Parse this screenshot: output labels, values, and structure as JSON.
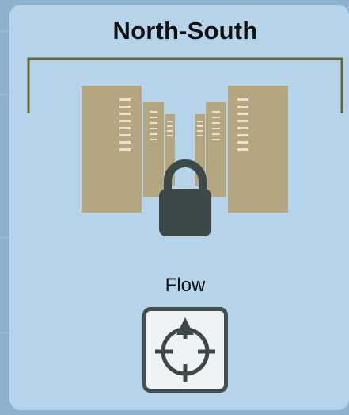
{
  "diagram": {
    "title": "North-South",
    "flow_label": "Flow",
    "colors": {
      "server": "#b5a682",
      "server_dark": "#9b8f6a",
      "server_slot": "#e9e1c9",
      "bracket": "#6b6432",
      "lock": "#3d4849",
      "icon_stroke": "#3d4849",
      "card": "#b5d4ea"
    },
    "icons": {
      "lock": "lock-icon",
      "flow": "crosshair-target-icon"
    }
  }
}
